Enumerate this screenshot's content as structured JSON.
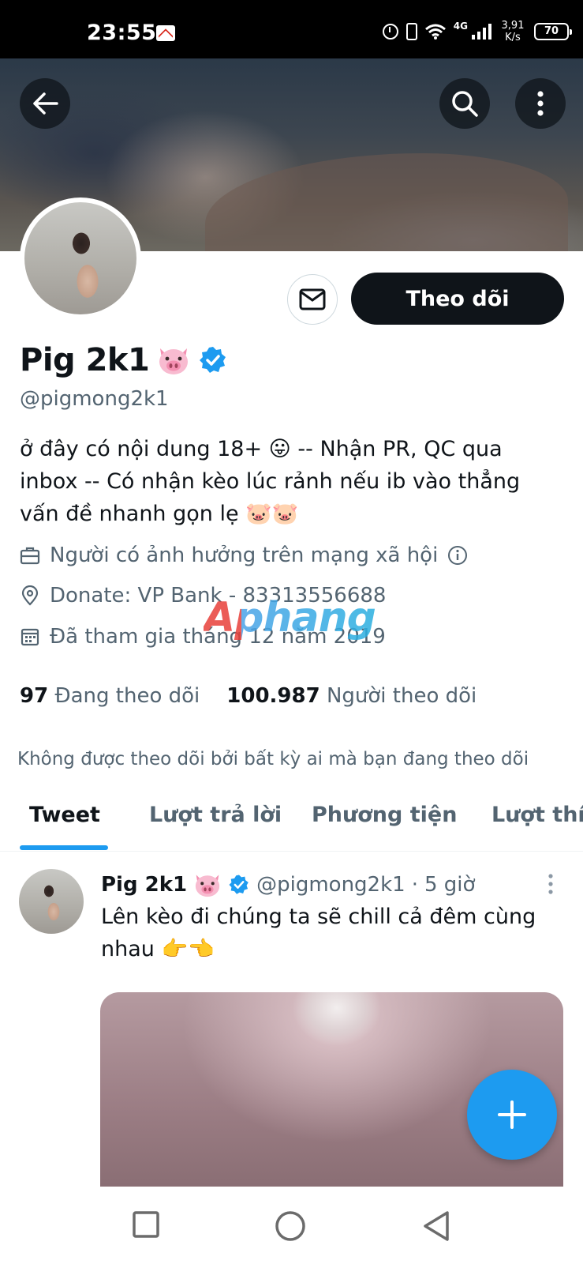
{
  "status_bar": {
    "time": "23:55",
    "network": "4G",
    "speed_value": "3,91",
    "speed_unit": "K/s",
    "battery": "70",
    "icons": [
      "gmail-icon",
      "alarm-icon",
      "vibrate-icon",
      "wifi-icon",
      "signal-icon",
      "battery-icon"
    ]
  },
  "header": {
    "back_icon": "arrow-left-icon",
    "search_icon": "search-icon",
    "more_icon": "more-vertical-icon"
  },
  "profile": {
    "follow_label": "Theo dõi",
    "message_icon": "mail-icon",
    "display_name": "Pig 2k1",
    "name_emoji": "pig-face",
    "verified": true,
    "handle": "@pigmong2k1",
    "bio_line1": "ở đây có nội dung 18+ 😛 -- Nhận PR, QC qua",
    "bio_line2": "inbox -- Có nhận kèo lúc rảnh nếu ib vào thẳng",
    "bio_line3": "vấn đề nhanh gọn lẹ 🐷🐷",
    "category": "Người có ảnh hưởng trên mạng xã hội",
    "location": "Donate: VP Bank - 83313556688",
    "joined": "Đã tham gia tháng 12 năm 2019",
    "following_count": "97",
    "following_label": "Đang theo dõi",
    "followers_count": "100.987",
    "followers_label": "Người theo dõi",
    "not_followed_note": "Không được theo dõi bởi bất kỳ ai mà bạn đang theo dõi"
  },
  "watermark": "Aphang",
  "tabs": [
    {
      "label": "Tweet",
      "active": true
    },
    {
      "label": "Lượt trả lời",
      "active": false
    },
    {
      "label": "Phương tiện",
      "active": false
    },
    {
      "label": "Lượt thích",
      "active": false
    }
  ],
  "tweet": {
    "name": "Pig 2k1",
    "handle": "@pigmong2k1",
    "separator": "·",
    "time": "5 giờ",
    "text_line1": "Lên kèo đi chúng ta sẽ chill cả đêm cùng",
    "text_line2": "nhau 👉👈"
  },
  "fab_icon": "plus-icon",
  "nav_bar": {
    "icons": [
      "recents-square-icon",
      "home-circle-icon",
      "back-triangle-icon"
    ]
  },
  "colors": {
    "accent": "#1d9bf0",
    "text_primary": "#0f1419",
    "text_secondary": "#536471",
    "follow_button_bg": "#0f1419"
  }
}
